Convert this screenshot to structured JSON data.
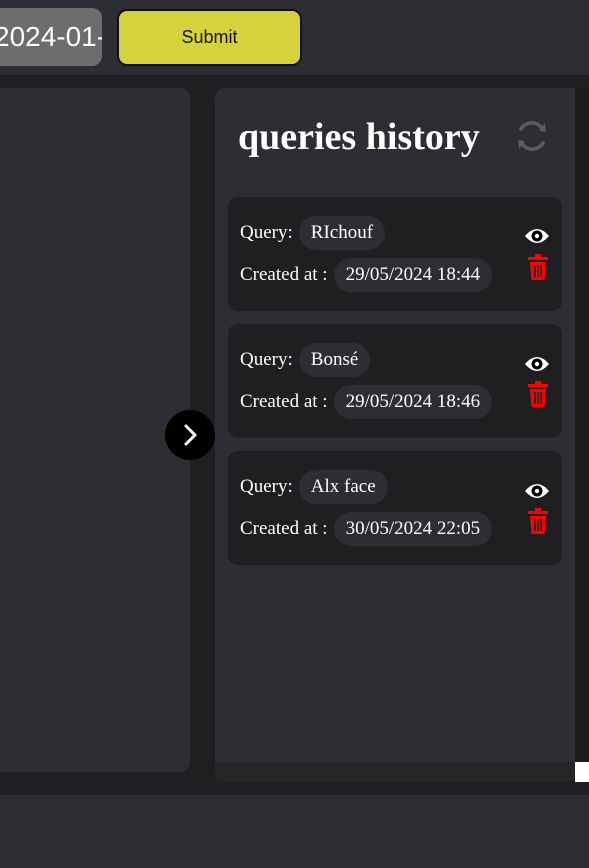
{
  "toolbar": {
    "date_value": "2024-01-",
    "submit_label": "Submit"
  },
  "history": {
    "title": "queries history",
    "query_label": "Query:",
    "created_label": "Created at :",
    "items": [
      {
        "query": "RIchouf",
        "created_at": "29/05/2024 18:44"
      },
      {
        "query": "Bonsé",
        "created_at": "29/05/2024 18:46"
      },
      {
        "query": "Alx face",
        "created_at": "30/05/2024 22:05"
      }
    ]
  },
  "colors": {
    "accent": "#d4d33c",
    "delete": "#ff0000",
    "panel": "#2d2e33",
    "card": "#1f1f21"
  },
  "icons": {
    "refresh": "refresh-icon",
    "toggle": "chevron-right-icon",
    "view": "eye-icon",
    "delete": "trash-icon"
  }
}
